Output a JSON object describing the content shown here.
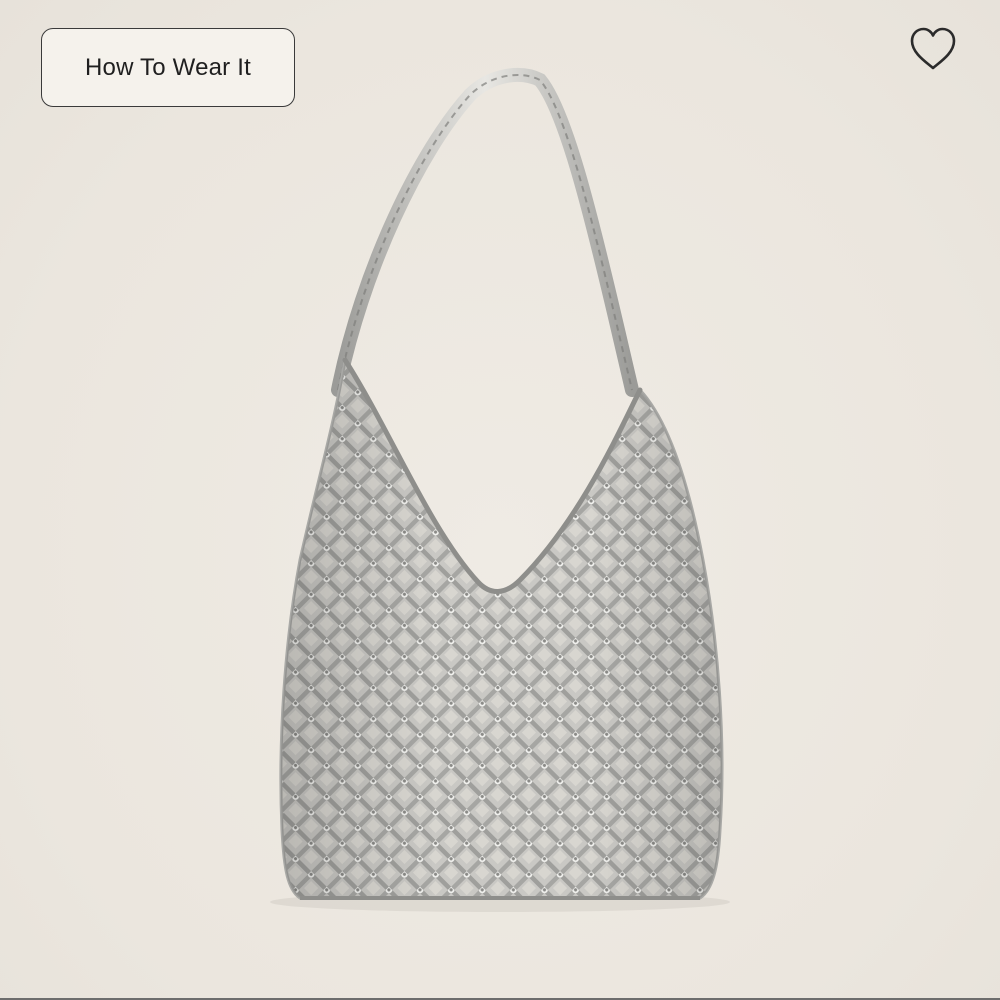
{
  "product_card": {
    "how_to_wear_label": "How To Wear It",
    "favorite_icon": "heart-outline-icon",
    "product_image": "metallic-crochet-shoulder-bag",
    "colors": {
      "background": "#eeeae2",
      "button_border": "#3a3a3a",
      "bag_silver": "#b9b9b6"
    }
  }
}
